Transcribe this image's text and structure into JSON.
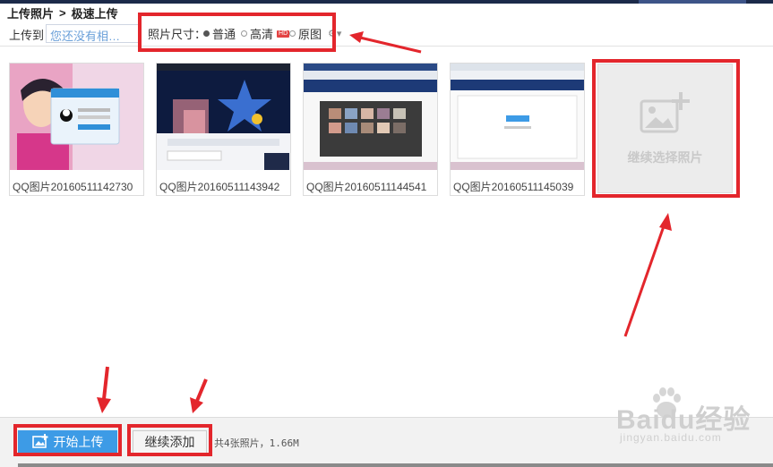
{
  "breadcrumb": {
    "root": "上传照片",
    "separator": ">",
    "current": "极速上传"
  },
  "toolbar": {
    "upload_to_label": "上传到",
    "album_placeholder": "您还没有相…",
    "size_label": "照片尺寸：",
    "options": [
      {
        "label": "普通",
        "selected": true
      },
      {
        "label": "高清",
        "selected": false,
        "badge": "HD"
      },
      {
        "label": "原图",
        "selected": false
      }
    ]
  },
  "photos": [
    {
      "caption": "QQ图片20160511142730"
    },
    {
      "caption": "QQ图片20160511143942"
    },
    {
      "caption": "QQ图片20160511144541"
    },
    {
      "caption": "QQ图片20160511145039"
    }
  ],
  "add_more": {
    "label": "继续选择照片",
    "icon": "add-image-icon"
  },
  "bottom": {
    "start_label": "开始上传",
    "add_label": "继续添加",
    "summary": "共4张照片，1.66M"
  },
  "watermark": {
    "main": "Baidu经验",
    "sub": "jingyan.baidu.com"
  },
  "colors": {
    "accent": "#3d9be6",
    "annotation": "#e3262c",
    "link": "#6aa0d9"
  }
}
